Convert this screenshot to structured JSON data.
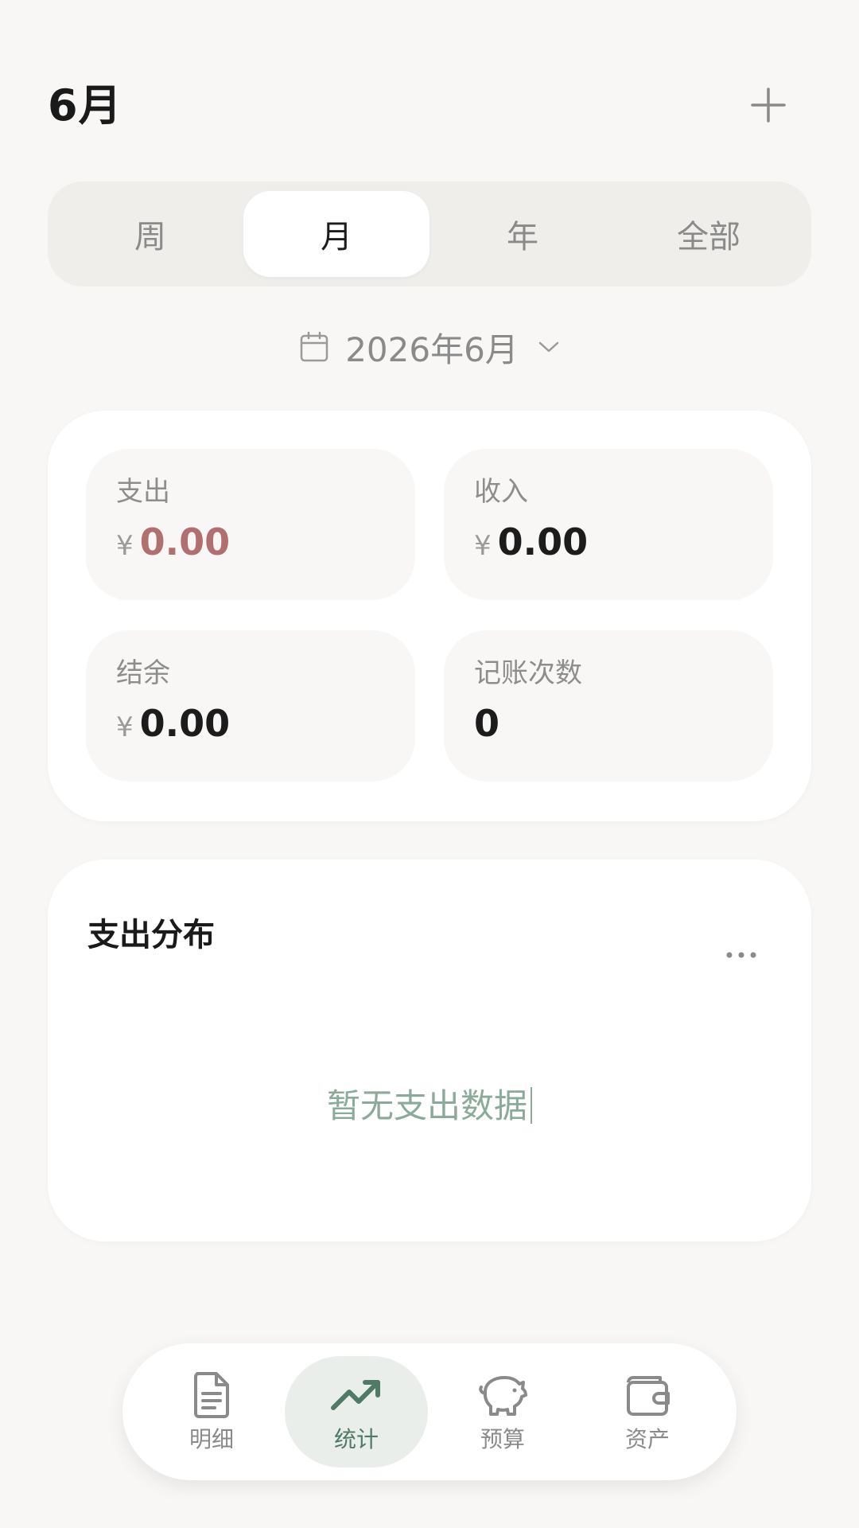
{
  "header": {
    "title": "6月"
  },
  "tabs": [
    {
      "label": "周",
      "active": false
    },
    {
      "label": "月",
      "active": true
    },
    {
      "label": "年",
      "active": false
    },
    {
      "label": "全部",
      "active": false
    }
  ],
  "date_selector": {
    "label": "2026年6月"
  },
  "summary": {
    "currency": "¥",
    "expense": {
      "label": "支出",
      "value": "0.00"
    },
    "income": {
      "label": "收入",
      "value": "0.00"
    },
    "balance": {
      "label": "结余",
      "value": "0.00"
    },
    "count": {
      "label": "记账次数",
      "value": "0"
    }
  },
  "distribution": {
    "title": "支出分布",
    "empty_text": "暂无支出数据"
  },
  "nav": [
    {
      "label": "明细",
      "icon": "document-icon",
      "active": false
    },
    {
      "label": "统计",
      "icon": "trending-up-icon",
      "active": true
    },
    {
      "label": "预算",
      "icon": "piggy-bank-icon",
      "active": false
    },
    {
      "label": "资产",
      "icon": "wallet-icon",
      "active": false
    }
  ],
  "colors": {
    "background": "#f8f7f5",
    "accent": "#4f7a66",
    "expense": "#b07070",
    "muted": "#8a8a8a"
  }
}
